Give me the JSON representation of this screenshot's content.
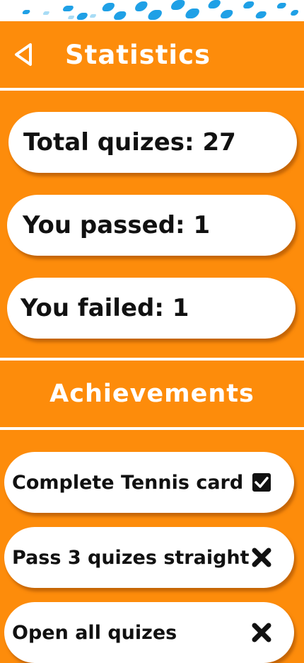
{
  "header": {
    "title": "Statistics"
  },
  "stats": {
    "total": "Total quizes: 27",
    "passed": "You passed: 1",
    "failed": "You failed: 1"
  },
  "achievements_section": {
    "title": "Achievements",
    "items": [
      {
        "label": "Complete Tennis card",
        "status": "completed",
        "icon": "checkbox-checked-icon"
      },
      {
        "label": "Pass 3 quizes straight",
        "status": "not-completed",
        "icon": "cross-icon"
      },
      {
        "label": "Open all quizes",
        "status": "not-completed",
        "icon": "cross-icon"
      }
    ]
  },
  "colors": {
    "background": "#FD8C0B",
    "card": "#FFFFFF",
    "text": "#111111",
    "header_text": "#FFFFFF"
  }
}
